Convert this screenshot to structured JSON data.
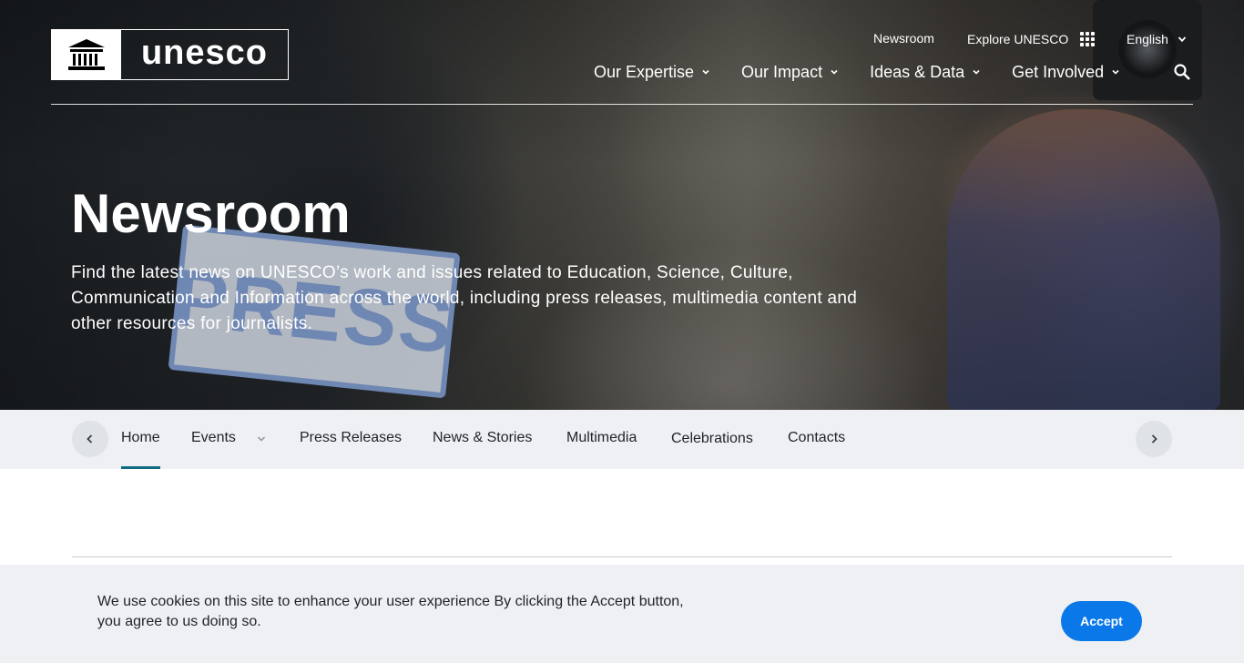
{
  "brand": {
    "name": "unesco"
  },
  "utility": {
    "newsroom": "Newsroom",
    "explore": "Explore UNESCO",
    "language": "English"
  },
  "nav": {
    "items": [
      "Our Expertise",
      "Our Impact",
      "Ideas & Data",
      "Get Involved"
    ]
  },
  "hero": {
    "sign_text": "PRESS",
    "title": "Newsroom",
    "description": "Find the latest news on UNESCO’s work and issues related to Education, Science, Culture, Communication and Information across the world, including press releases, multimedia content and other resources for journalists."
  },
  "subnav": {
    "tabs": [
      "Home",
      "Events",
      "Press Releases",
      "News & Stories",
      "Multimedia",
      "Celebrations",
      "Contacts"
    ],
    "active": "Home"
  },
  "cookie": {
    "message": "We use cookies on this site to enhance your user experience  By clicking the Accept button, you agree to us doing so.",
    "accept_label": "Accept"
  },
  "colors": {
    "accent": "#0a78e8",
    "active_tab": "#0f6a86",
    "subnav_bg": "#eef0f3"
  }
}
